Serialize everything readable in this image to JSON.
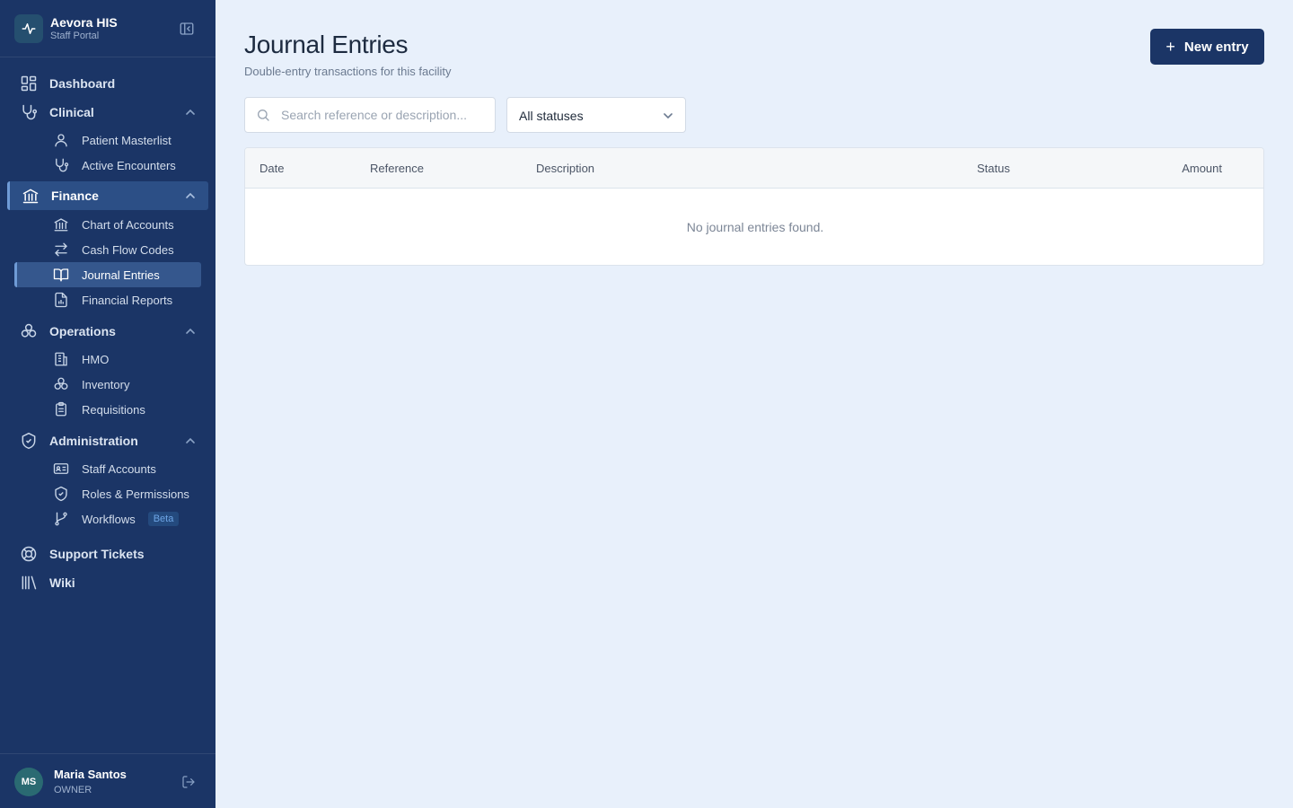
{
  "brand": {
    "name": "Aevora HIS",
    "subtitle": "Staff Portal"
  },
  "nav": {
    "dashboard": "Dashboard",
    "clinical": {
      "label": "Clinical",
      "items": [
        "Patient Masterlist",
        "Active Encounters"
      ]
    },
    "finance": {
      "label": "Finance",
      "items": [
        "Chart of Accounts",
        "Cash Flow Codes",
        "Journal Entries",
        "Financial Reports"
      ]
    },
    "operations": {
      "label": "Operations",
      "items": [
        "HMO",
        "Inventory",
        "Requisitions"
      ]
    },
    "administration": {
      "label": "Administration",
      "items": [
        "Staff Accounts",
        "Roles & Permissions",
        "Workflows"
      ],
      "workflows_badge": "Beta"
    },
    "support": "Support Tickets",
    "wiki": "Wiki"
  },
  "user": {
    "initials": "MS",
    "name": "Maria Santos",
    "role": "OWNER"
  },
  "page": {
    "title": "Journal Entries",
    "subtitle": "Double-entry transactions for this facility",
    "new_button": "New entry",
    "search_placeholder": "Search reference or description...",
    "status_filter": "All statuses"
  },
  "table": {
    "columns": [
      "Date",
      "Reference",
      "Description",
      "Status",
      "Amount"
    ],
    "rows": [],
    "empty_message": "No journal entries found."
  },
  "colors": {
    "sidebar_bg": "#1b3566",
    "page_bg": "#e8f0fb",
    "primary": "#1b3566",
    "active_item": "#35578d",
    "badge": "#6ea5e6"
  }
}
